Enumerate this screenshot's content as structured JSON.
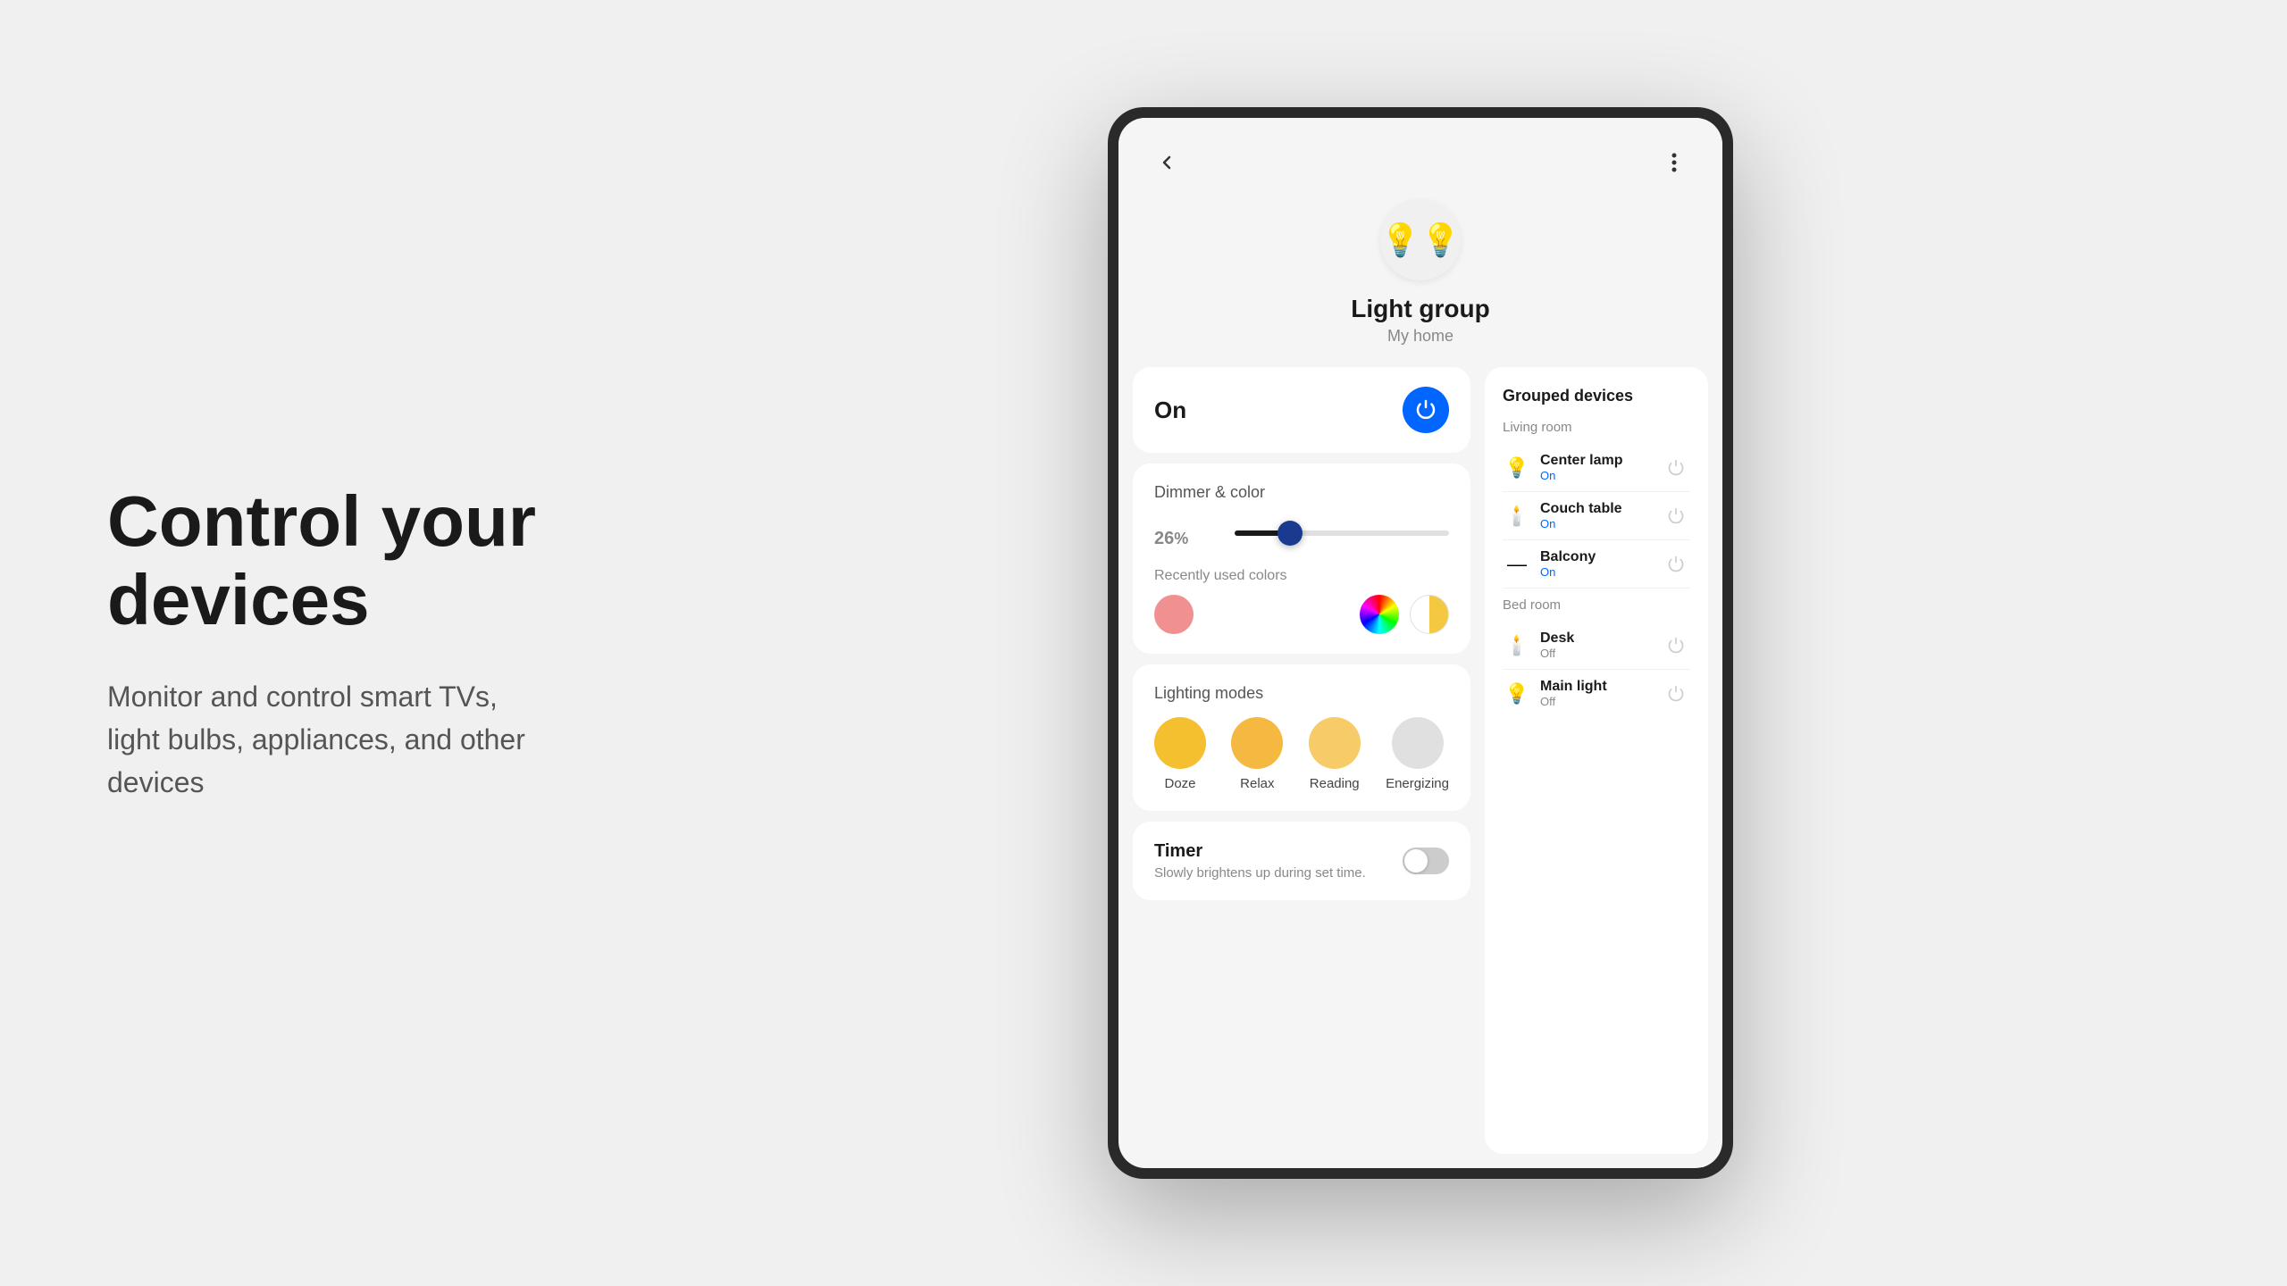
{
  "left": {
    "headline_line1": "Control your",
    "headline_line2": "devices",
    "description": "Monitor and control smart TVs, light bulbs, appliances, and other devices"
  },
  "app": {
    "device_icon": "💡",
    "device_name": "Light group",
    "device_location": "My home",
    "power_status": "On",
    "dimmer": {
      "title": "Dimmer & color",
      "value": "26",
      "unit": "%",
      "percent": 26
    },
    "colors": {
      "title": "Recently used colors",
      "swatches": [
        {
          "color": "#f09090"
        },
        {
          "color": "wheel"
        },
        {
          "color": "half"
        }
      ]
    },
    "modes": {
      "title": "Lighting modes",
      "items": [
        {
          "label": "Doze",
          "color": "#f5c030"
        },
        {
          "label": "Relax",
          "color": "#f5b840"
        },
        {
          "label": "Reading",
          "color": "#f7cc68"
        },
        {
          "label": "Energizing",
          "color": "#e0e0e0"
        }
      ]
    },
    "timer": {
      "title": "Timer",
      "description": "Slowly brightens up during set time.",
      "enabled": false
    },
    "grouped": {
      "title": "Grouped devices",
      "rooms": [
        {
          "name": "Living room",
          "devices": [
            {
              "name": "Center lamp",
              "status": "On",
              "on": true,
              "icon": "💡"
            },
            {
              "name": "Couch table",
              "status": "On",
              "on": true,
              "icon": "🕯️"
            },
            {
              "name": "Balcony",
              "status": "On",
              "on": true,
              "icon": "—"
            }
          ]
        },
        {
          "name": "Bed room",
          "devices": [
            {
              "name": "Desk",
              "status": "Off",
              "on": false,
              "icon": "🕯️"
            },
            {
              "name": "Main light",
              "status": "Off",
              "on": false,
              "icon": "💡"
            }
          ]
        }
      ]
    }
  }
}
